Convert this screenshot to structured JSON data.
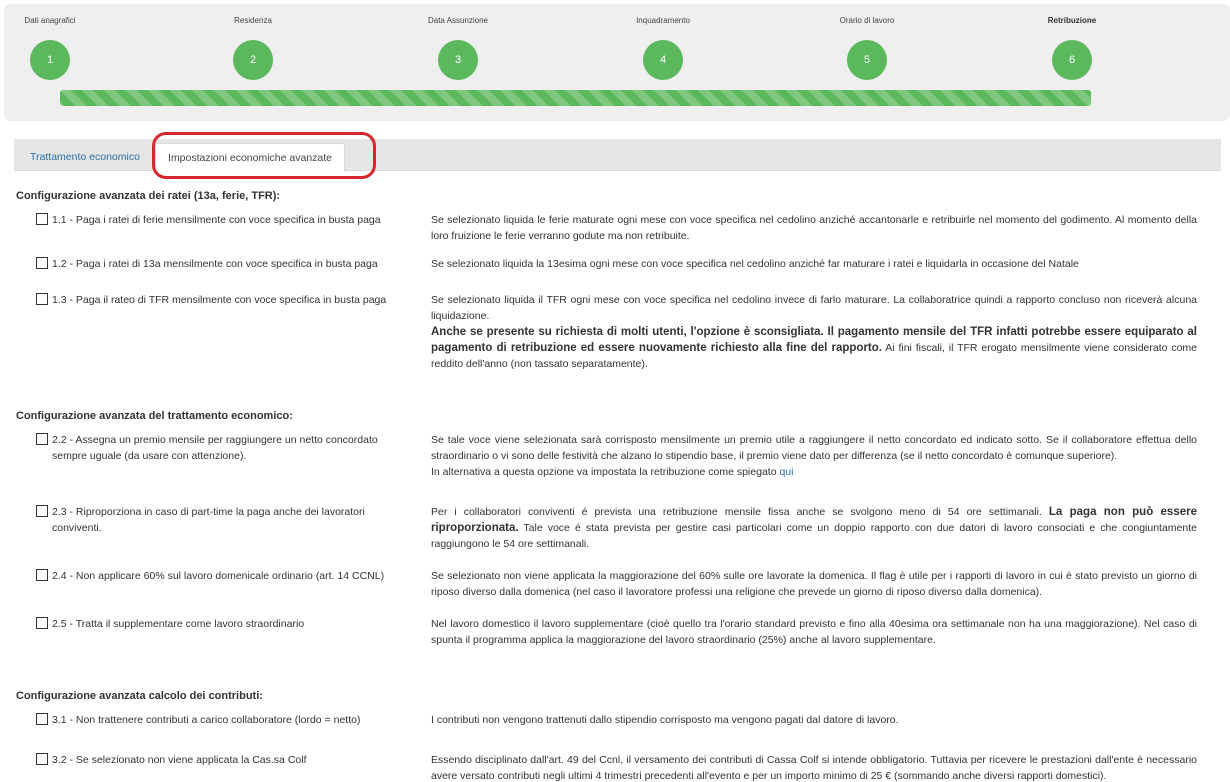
{
  "wizard": {
    "steps": [
      {
        "label": "Dati anagrafici",
        "number": "1"
      },
      {
        "label": "Residenza",
        "number": "2"
      },
      {
        "label": "Data Assunzione",
        "number": "3"
      },
      {
        "label": "Inquadramento",
        "number": "4"
      },
      {
        "label": "Orario di lavoro",
        "number": "5"
      },
      {
        "label": "Retribuzione",
        "number": "6"
      }
    ],
    "progress_percent": 100,
    "active_step": "6"
  },
  "tabs": [
    {
      "label": "Trattamento economico",
      "active": false
    },
    {
      "label": "Impostazioni economiche avanzate",
      "active": true
    }
  ],
  "sections": {
    "ratei_title": "Configurazione avanzata dei ratei (13a, ferie, TFR):",
    "trattamento_title": "Configurazione avanzata del trattamento economico:",
    "contributi_title": "Configurazione avanzata calcolo dei contributi:"
  },
  "options": {
    "o11": {
      "label": "1.1 - Paga i ratei di ferie mensilmente con voce specifica in busta paga",
      "checked": false,
      "desc": "Se selezionato liquida le ferie maturate ogni mese con voce specifica nel cedolino anziché accantonarle e retribuirle nel momento del godimento. Al momento della loro fruizione le ferie verranno godute ma non retribuite."
    },
    "o12": {
      "label": "1.2 - Paga i ratei di 13a mensilmente con voce specifica in busta paga",
      "checked": false,
      "desc": "Se selezionato liquida la 13esima ogni mese con voce specifica nel cedolino anziché far maturare i ratei e liquidarla in occasione del Natale"
    },
    "o13": {
      "label": "1.3 - Paga il rateo di TFR mensilmente con voce specifica in busta paga",
      "checked": false,
      "desc_1": "Se selezionato liquida il TFR ogni mese con voce specifica nel cedolino invece di farlo maturare. La collaboratrice quindi a rapporto concluso non riceverà alcuna liquidazione.",
      "desc_bold": "Anche se presente su richiesta di molti utenti, l'opzione è sconsigliata. Il pagamento mensile del TFR infatti potrebbe essere equiparato al pagamento di retribuzione ed essere nuovamente richiesto alla fine del rapporto.",
      "desc_2": " Ai fini fiscali, il TFR erogato mensilmente viene considerato come reddito dell'anno (non tassato separatamente)."
    },
    "o22": {
      "label": "2.2 - Assegna un premio mensile per raggiungere un netto concordato sempre uguale (da usare con attenzione).",
      "checked": false,
      "desc_1": "Se tale voce viene selezionata sarà corrisposto mensilmente un premio utile a raggiungere il netto concordato ed indicato sotto. Se il collaboratore effettua dello straordinario o vi sono delle festività che alzano lo stipendio base, il premio viene dato per differenza (se il netto concordato è comunque superiore).",
      "desc_2": "In alternativa a questa opzione va impostata la retribuzione come spiegato ",
      "link": "qui"
    },
    "o23": {
      "label": "2.3 - Riproporziona in caso di part-time la paga anche dei lavoratori conviventi.",
      "checked": false,
      "desc_1": "Per i collaboratori conviventi é prevista una retribuzione mensile fissa anche se svolgono meno di 54 ore settimanali. ",
      "desc_bold": "La paga non può essere riproporzionata.",
      "desc_2": " Tale voce é stata prevista per gestire casi particolari come un doppio rapporto con due datori di lavoro consociati e che congiuntamente raggiungono le 54 ore settimanali."
    },
    "o24": {
      "label": "2.4 - Non applicare 60% sul lavoro domenicale ordinario (art. 14 CCNL)",
      "checked": false,
      "desc": "Se selezionato non viene applicata la maggiorazione del 60% sulle ore lavorate la domenica. Il flag è utile per i rapporti di lavoro in cui è stato previsto un giorno di riposo diverso dalla domenica (nel caso il lavoratore professi una religione che prevede un giorno di riposo diverso dalla domenica)."
    },
    "o25": {
      "label": "2.5 - Tratta il supplementare come lavoro straordinario",
      "checked": false,
      "desc": "Nel lavoro domestico il lavoro supplementare (cioè quello tra l'orario standard previsto e fino alla 40esima ora settimanale non ha una maggiorazione). Nel caso di spunta il programma applica la maggiorazione del lavoro straordinario (25%) anche al lavoro supplementare."
    },
    "o31": {
      "label": "3.1 - Non trattenere contributi a carico collaboratore (lordo = netto)",
      "checked": false,
      "desc": "I contributi non vengono trattenuti dallo stipendio corrisposto ma vengono pagati dal datore di lavoro."
    },
    "o32": {
      "label": "3.2 - Se selezionato non viene applicata la Cas.sa Colf",
      "checked": false,
      "desc": "Essendo disciplinato dall'art. 49 del Ccnl, il versamento dei contributi di Cassa Colf si intende obbligatorio. Tuttavia per ricevere le prestazioni dall'ente è necessario avere versato contributi negli ultimi 4 trimestri precedenti all'evento e per un importo minimo di 25 € (sommando anche diversi rapporti domestici)."
    }
  },
  "colors": {
    "step_green": "#5cb85c",
    "link_blue": "#2a6fa8",
    "highlight_red": "#d7262c"
  }
}
